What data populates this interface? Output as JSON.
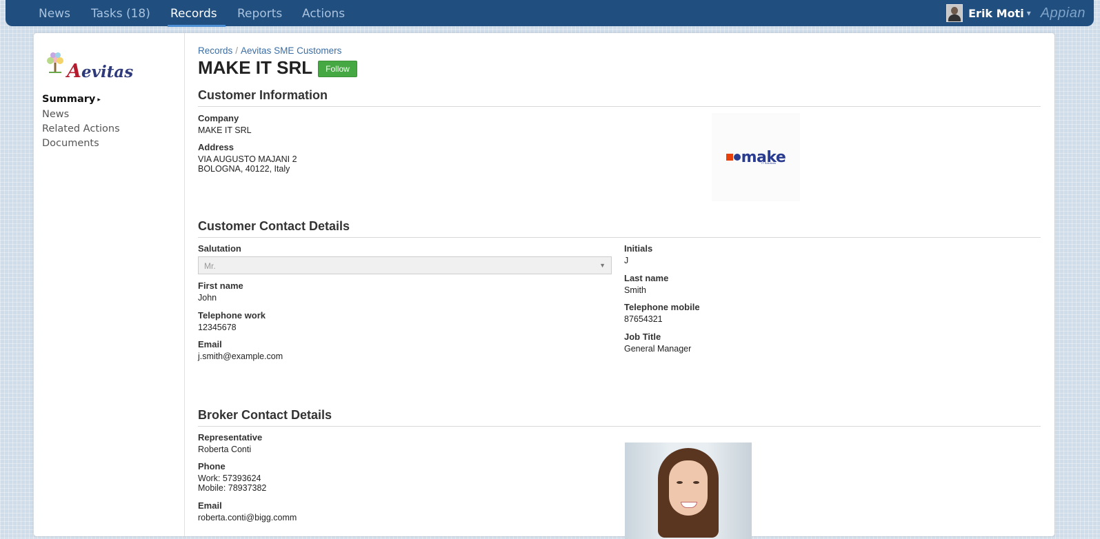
{
  "nav": {
    "items": [
      "News",
      "Tasks (18)",
      "Records",
      "Reports",
      "Actions"
    ],
    "active": "Records"
  },
  "user": {
    "name": "Erik Moti",
    "caret": "▾"
  },
  "brand": "Appian",
  "sidebar": {
    "logo_text_initial": "A",
    "logo_text_rest": "evitas",
    "items": [
      "Summary",
      "News",
      "Related Actions",
      "Documents"
    ],
    "active_arrow": "▸"
  },
  "breadcrumb": {
    "root": "Records",
    "separator": "/",
    "current": "Aevitas SME Customers"
  },
  "page": {
    "title": "MAKE IT SRL",
    "follow_label": "Follow"
  },
  "customer_info": {
    "section_title": "Customer Information",
    "company_label": "Company",
    "company": "MAKE IT SRL",
    "address_label": "Address",
    "address_line1": "VIA AUGUSTO MAJANI 2",
    "address_line2": "BOLOGNA, 40122, Italy",
    "logo_word": "make",
    "logo_sub": "IT Solutions"
  },
  "contact": {
    "section_title": "Customer Contact Details",
    "salutation_label": "Salutation",
    "salutation_value": "Mr.",
    "first_name_label": "First name",
    "first_name": "John",
    "tel_work_label": "Telephone work",
    "tel_work": "12345678",
    "email_label": "Email",
    "email": "j.smith@example.com",
    "initials_label": "Initials",
    "initials": "J",
    "last_name_label": "Last name",
    "last_name": "Smith",
    "tel_mobile_label": "Telephone mobile",
    "tel_mobile": "87654321",
    "job_title_label": "Job Title",
    "job_title": "General Manager"
  },
  "broker": {
    "section_title": "Broker Contact Details",
    "rep_label": "Representative",
    "rep": "Roberta Conti",
    "phone_label": "Phone",
    "phone_work": "Work: 57393624",
    "phone_mobile": "Mobile: 78937382",
    "email_label": "Email",
    "email": "roberta.conti@bigg.comm"
  }
}
